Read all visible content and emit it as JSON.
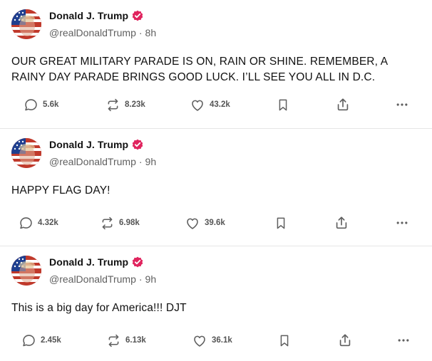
{
  "colors": {
    "verified_badge": "#e0245e",
    "text": "#111111",
    "muted": "#5f5f5f",
    "icon": "#5f5f5f",
    "divider": "#e6e6e6"
  },
  "posts": [
    {
      "author": {
        "name": "Donald J. Trump",
        "handle": "@realDonaldTrump",
        "verified": true,
        "avatar_icon": "flag-portrait-avatar"
      },
      "time": "8h",
      "text": "OUR GREAT MILITARY PARADE IS ON, RAIN OR SHINE. REMEMBER, A RAINY DAY PARADE BRINGS GOOD LUCK. I’LL SEE YOU ALL IN D.C.",
      "stats": {
        "replies": "5.6k",
        "reposts": "8.23k",
        "likes": "43.2k"
      },
      "icons": [
        "reply-icon",
        "repost-icon",
        "like-icon",
        "bookmark-icon",
        "share-icon",
        "more-icon"
      ]
    },
    {
      "author": {
        "name": "Donald J. Trump",
        "handle": "@realDonaldTrump",
        "verified": true,
        "avatar_icon": "flag-portrait-avatar"
      },
      "time": "9h",
      "text": "HAPPY FLAG DAY!",
      "stats": {
        "replies": "4.32k",
        "reposts": "6.98k",
        "likes": "39.6k"
      },
      "icons": [
        "reply-icon",
        "repost-icon",
        "like-icon",
        "bookmark-icon",
        "share-icon",
        "more-icon"
      ]
    },
    {
      "author": {
        "name": "Donald J. Trump",
        "handle": "@realDonaldTrump",
        "verified": true,
        "avatar_icon": "flag-portrait-avatar"
      },
      "time": "9h",
      "text": "This is a big day for America!!! DJT",
      "stats": {
        "replies": "2.45k",
        "reposts": "6.13k",
        "likes": "36.1k"
      },
      "icons": [
        "reply-icon",
        "repost-icon",
        "like-icon",
        "bookmark-icon",
        "share-icon",
        "more-icon"
      ]
    }
  ],
  "meta_separator": "·"
}
